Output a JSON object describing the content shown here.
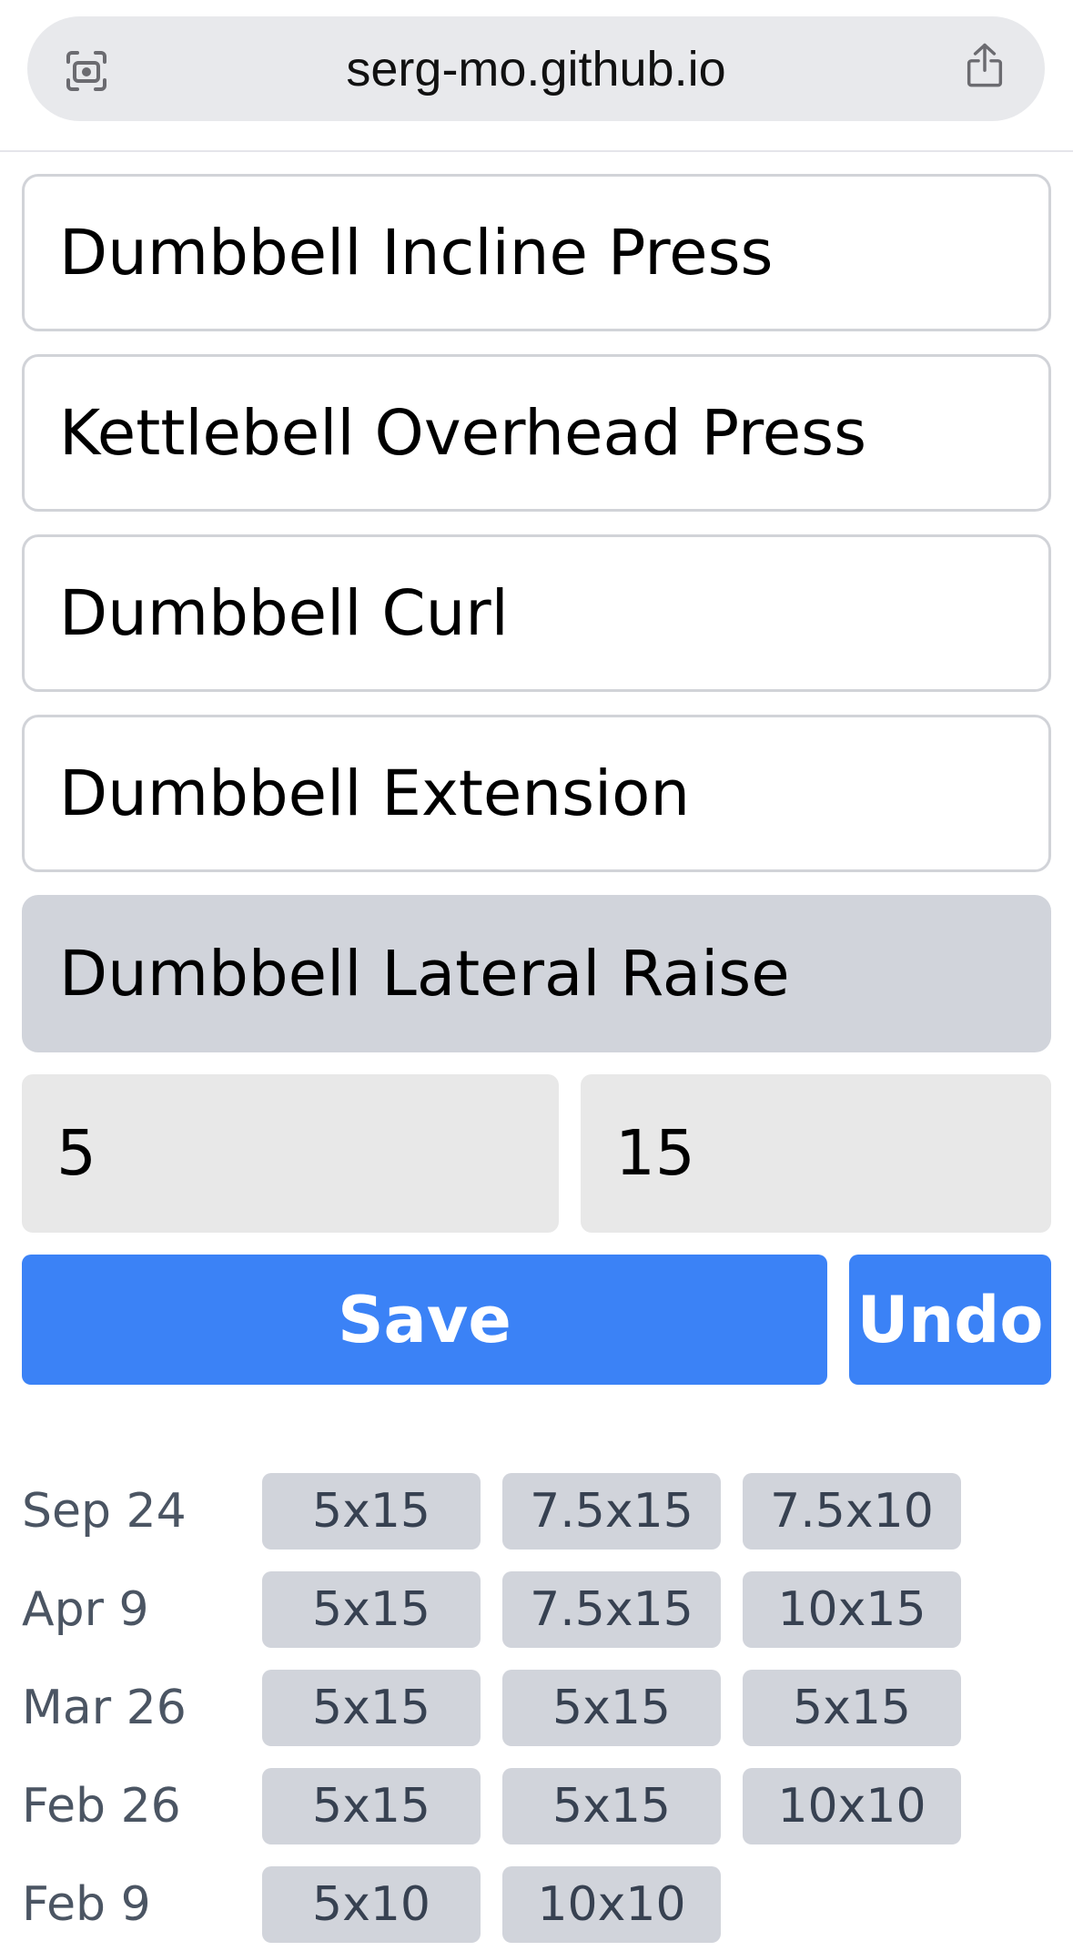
{
  "browser": {
    "url": "serg-mo.github.io"
  },
  "exercises": [
    {
      "name": "Dumbbell Incline Press",
      "selected": false
    },
    {
      "name": "Kettlebell Overhead Press",
      "selected": false
    },
    {
      "name": "Dumbbell Curl",
      "selected": false
    },
    {
      "name": "Dumbbell Extension",
      "selected": false
    },
    {
      "name": "Dumbbell Lateral Raise",
      "selected": true
    }
  ],
  "inputs": {
    "weight": "5",
    "reps": "15"
  },
  "actions": {
    "save_label": "Save",
    "undo_label": "Undo"
  },
  "history": [
    {
      "date": "Sep 24",
      "sets": [
        "5x15",
        "7.5x15",
        "7.5x10"
      ]
    },
    {
      "date": "Apr 9",
      "sets": [
        "5x15",
        "7.5x15",
        "10x15"
      ]
    },
    {
      "date": "Mar 26",
      "sets": [
        "5x15",
        "5x15",
        "5x15"
      ]
    },
    {
      "date": "Feb 26",
      "sets": [
        "5x15",
        "5x15",
        "10x10"
      ]
    },
    {
      "date": "Feb 9",
      "sets": [
        "5x10",
        "10x10"
      ]
    }
  ],
  "colors": {
    "accent": "#3b82f6",
    "chip_bg": "#d1d4db",
    "selected_bg": "#d1d4db"
  }
}
